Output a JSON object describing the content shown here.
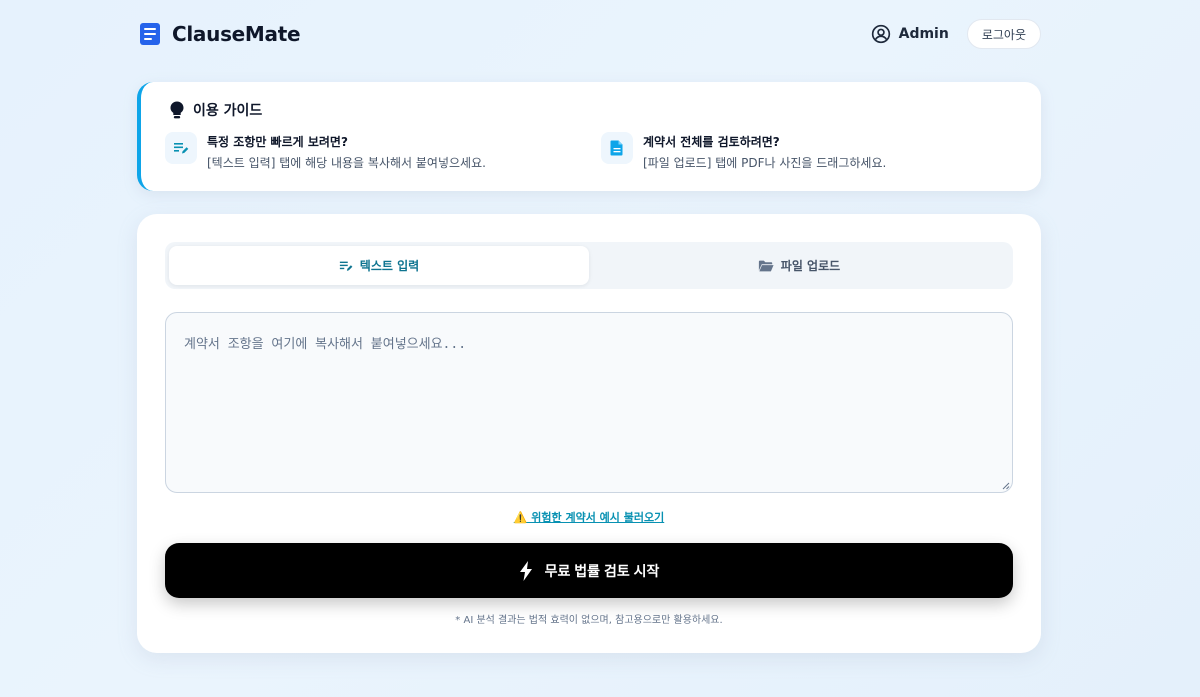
{
  "header": {
    "brand": "ClauseMate",
    "user_name": "Admin",
    "logout_label": "로그아웃"
  },
  "guide": {
    "title": "이용 가이드",
    "tips": [
      {
        "icon": "edit-note-icon",
        "title": "특정 조항만 빠르게 보려면?",
        "desc": "[텍스트 입력] 탭에 해당 내용을 복사해서 붙여넣으세요."
      },
      {
        "icon": "document-icon",
        "title": "계약서 전체를 검토하려면?",
        "desc": "[파일 업로드] 탭에 PDF나 사진을 드래그하세요."
      }
    ]
  },
  "tabs": [
    {
      "label": "텍스트 입력",
      "icon": "edit-note-icon",
      "active": true
    },
    {
      "label": "파일 업로드",
      "icon": "folder-open-icon",
      "active": false
    }
  ],
  "input": {
    "value": "",
    "placeholder": "계약서 조항을 여기에 복사해서 붙여넣으세요..."
  },
  "example_link": "⚠️ 위험한 계약서 예시 불러오기",
  "start_button": "무료 법률 검토 시작",
  "disclaimer": "* AI 분석 결과는 법적 효력이 없으며, 참고용으로만 활용하세요.",
  "colors": {
    "brand": "#2563eb",
    "accent": "#0ea5e9",
    "link": "#0891b2",
    "button": "#000000"
  }
}
